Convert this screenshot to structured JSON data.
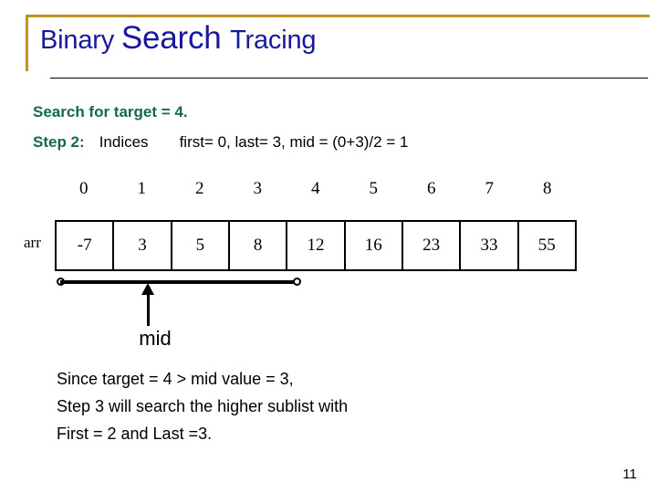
{
  "slide": {
    "title_parts": [
      {
        "text": "Binary ",
        "size": "small"
      },
      {
        "text": "Search ",
        "size": "large"
      },
      {
        "text": "Tracing",
        "size": "small"
      }
    ],
    "title_plain": "Binary Search Tracing",
    "title_color": "#18189c",
    "accent_color": "#bf9425",
    "page_number": "11"
  },
  "body": {
    "search_line": "Search for target = 4.",
    "step_label": "Step 2:",
    "indices_label": "Indices",
    "bounds_label": "first= 0, last= 3, mid = (0+3)/2 = 1",
    "accent_text_color": "#136b43"
  },
  "array": {
    "name_label": "arr",
    "indices": [
      "0",
      "1",
      "2",
      "3",
      "4",
      "5",
      "6",
      "7",
      "8"
    ],
    "values": [
      "-7",
      "3",
      "5",
      "8",
      "12",
      "16",
      "23",
      "33",
      "55"
    ],
    "pointer_label": "mid",
    "range_first_index": 0,
    "range_last_index": 3,
    "mid_index": 1
  },
  "conclusion": {
    "lines": [
      "Since target = 4 > mid value = 3,",
      "Step 3 will search the higher sublist with",
      "First = 2 and Last =3."
    ]
  }
}
